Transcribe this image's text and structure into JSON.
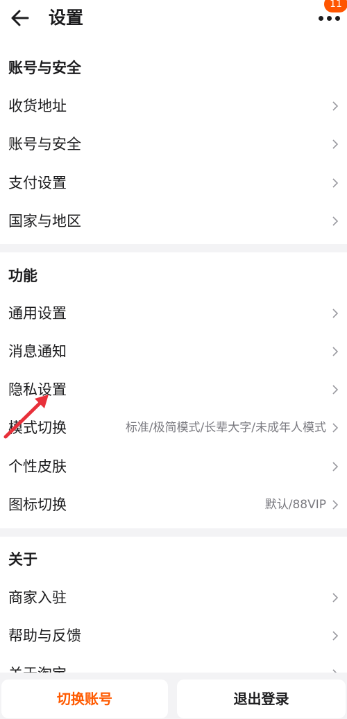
{
  "header": {
    "title": "设置",
    "back_icon": "arrow-left-icon",
    "more_icon": "more-dots-icon",
    "badge_count": "11"
  },
  "sections": [
    {
      "title": "账号与安全",
      "items": [
        {
          "label": "收货地址",
          "value": ""
        },
        {
          "label": "账号与安全",
          "value": ""
        },
        {
          "label": "支付设置",
          "value": ""
        },
        {
          "label": "国家与地区",
          "value": ""
        }
      ]
    },
    {
      "title": "功能",
      "items": [
        {
          "label": "通用设置",
          "value": ""
        },
        {
          "label": "消息通知",
          "value": ""
        },
        {
          "label": "隐私设置",
          "value": ""
        },
        {
          "label": "模式切换",
          "value": "标准/极简模式/长辈大字/未成年人模式"
        },
        {
          "label": "个性皮肤",
          "value": ""
        },
        {
          "label": "图标切换",
          "value": "默认/88VIP"
        }
      ]
    },
    {
      "title": "关于",
      "items": [
        {
          "label": "商家入驻",
          "value": ""
        },
        {
          "label": "帮助与反馈",
          "value": ""
        },
        {
          "label": "关于淘宝",
          "value": ""
        }
      ]
    }
  ],
  "footer": {
    "switch_account": "切换账号",
    "logout": "退出登录"
  },
  "colors": {
    "accent": "#ff5a00",
    "badge": "#ff5500",
    "background": "#f3f3f5",
    "annotation_arrow": "#e8303a"
  }
}
